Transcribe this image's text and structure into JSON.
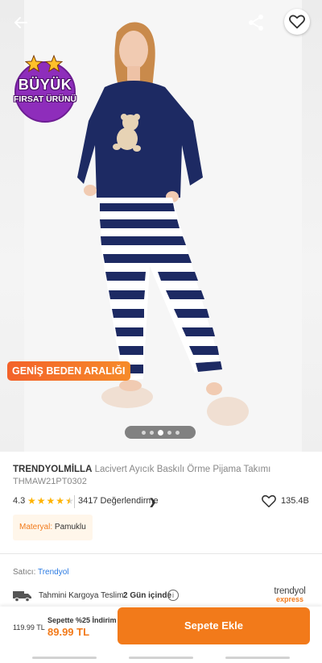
{
  "header": {
    "back_icon": "arrow-left-icon",
    "share_icon": "share-icon",
    "favorite_icon": "heart-outline-icon"
  },
  "badges": {
    "big_deal_line1": "BÜYÜK",
    "big_deal_line2": "FIRSAT ÜRÜNÜ",
    "size_range": "GENİŞ BEDEN ARALIĞI"
  },
  "gallery": {
    "dot_count": 5,
    "active_index": 2
  },
  "product": {
    "brand": "TRENDYOLMİLLA",
    "name": "Lacivert Ayıcık Baskılı Örme Pijama Takımı",
    "sku": "THMAW21PT0302",
    "rating": "4.3",
    "rating_value": 4.3,
    "review_count": "3417 Değerlendirme",
    "favorite_count": "135.4B",
    "material_key": "Materyal:",
    "material_value": "Pamuklu"
  },
  "seller": {
    "label": "Satıcı:",
    "name": "Trendyol"
  },
  "delivery": {
    "label": "Tahmini Kargoya Teslim:",
    "value": "2 Gün içinde",
    "logo_line1": "trendyol",
    "logo_line2": "express"
  },
  "cart": {
    "old_price": "119.99 TL",
    "discount_label": "Sepette %25 İndirim",
    "new_price": "89.99 TL",
    "button_label": "Sepete Ekle"
  },
  "colors": {
    "accent": "#f27a1a",
    "badge_purple": "#8e2dbb",
    "link_blue": "#2a7ae2",
    "star": "#ffb300"
  }
}
